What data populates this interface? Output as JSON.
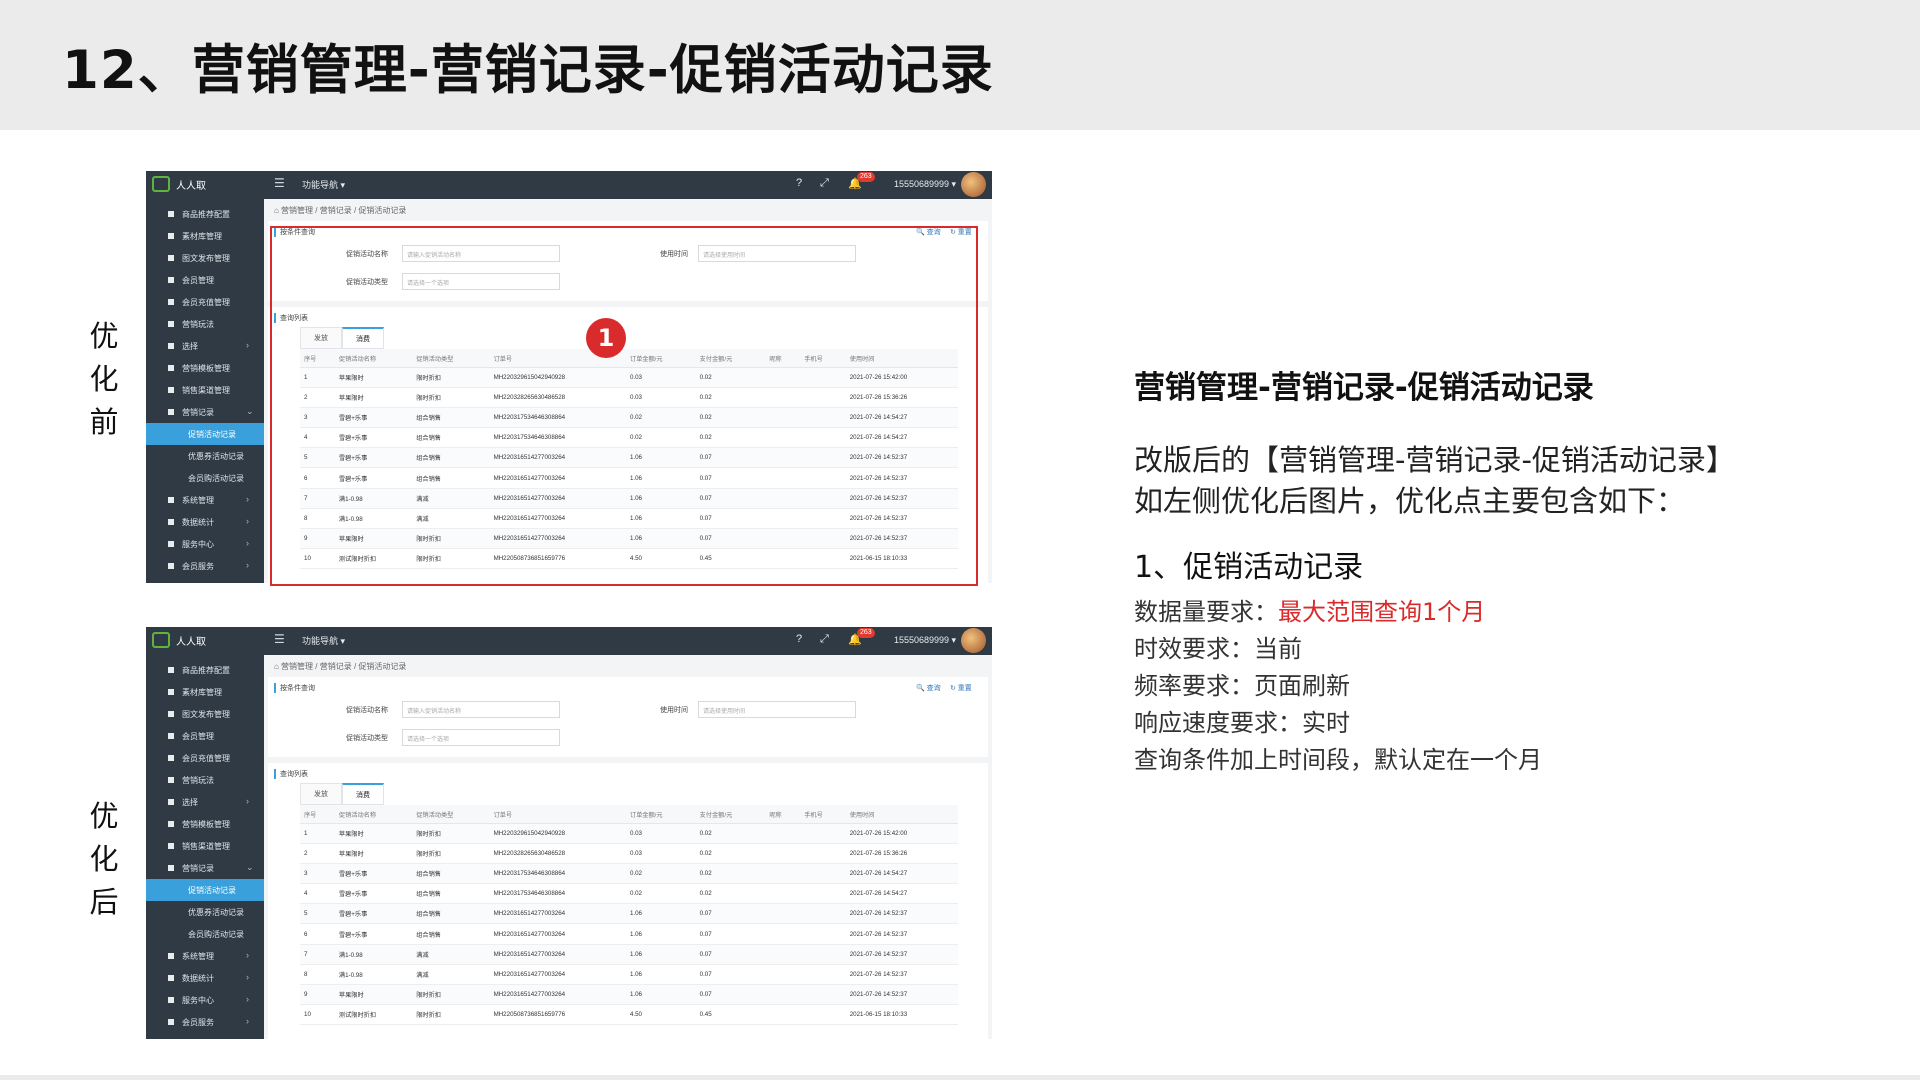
{
  "slide": {
    "title": "12、营销管理-营销记录-促销活动记录",
    "label_before": [
      "优",
      "化",
      "前"
    ],
    "label_after": [
      "优",
      "化",
      "后"
    ],
    "marker": "1"
  },
  "app": {
    "brand": "人人取",
    "nav": "功能导航 ▾",
    "help": "?",
    "fullscreen": "⤢",
    "bell": "♫",
    "badge": "263",
    "user": "15550689999 ▾",
    "sidebar": [
      {
        "label": "商品推荐配置",
        "chev": ""
      },
      {
        "label": "素材库管理",
        "chev": ""
      },
      {
        "label": "图文发布管理",
        "chev": ""
      },
      {
        "label": "会员管理",
        "chev": ""
      },
      {
        "label": "会员充值管理",
        "chev": ""
      },
      {
        "label": "营销玩法",
        "chev": ""
      },
      {
        "label": "选择",
        "chev": "›"
      },
      {
        "label": "营销模板管理",
        "chev": ""
      },
      {
        "label": "销售渠道管理",
        "chev": ""
      },
      {
        "label": "营销记录",
        "chev": "⌄"
      },
      {
        "label": "促销活动记录",
        "chev": "",
        "sub": true,
        "active": true
      },
      {
        "label": "优惠券活动记录",
        "chev": "",
        "sub": true
      },
      {
        "label": "会员购活动记录",
        "chev": "",
        "sub": true
      },
      {
        "label": "系统管理",
        "chev": "›"
      },
      {
        "label": "数据统计",
        "chev": "›"
      },
      {
        "label": "服务中心",
        "chev": "›"
      },
      {
        "label": "会员服务",
        "chev": "›"
      }
    ],
    "breadcrumb": "⌂  营销管理 / 营销记录 / 促销活动记录",
    "query": {
      "title": "按条件查询",
      "name_label": "促销活动名称",
      "name_placeholder": "请输入促销活动名称",
      "time_label": "使用时间",
      "time_placeholder": "请选择使用时间",
      "type_label": "促销活动类型",
      "type_placeholder": "请选择一个选项",
      "search": "🔍 查询",
      "reset": "↻ 重置"
    },
    "list_title": "查询列表",
    "tabs": [
      "发放",
      "消费"
    ],
    "columns": [
      "序号",
      "促销活动名称",
      "促销活动类型",
      "订单号",
      "订单金额/元",
      "支付金额/元",
      "昵称",
      "手机号",
      "使用时间"
    ],
    "rows": [
      [
        "1",
        "苹果限时",
        "限时折扣",
        "MH2203296150429409​28",
        "0.03",
        "0.02",
        "",
        "",
        "2021-07-26 15:42:00"
      ],
      [
        "2",
        "苹果限时",
        "限时折扣",
        "MH220328265630486528",
        "0.03",
        "0.02",
        "",
        "",
        "2021-07-26 15:36:26"
      ],
      [
        "3",
        "雪碧+乐事",
        "组合销售",
        "MH220317534646308864",
        "0.02",
        "0.02",
        "",
        "",
        "2021-07-26 14:54:27"
      ],
      [
        "4",
        "雪碧+乐事",
        "组合销售",
        "MH220317534646308864",
        "0.02",
        "0.02",
        "",
        "",
        "2021-07-26 14:54:27"
      ],
      [
        "5",
        "雪碧+乐事",
        "组合销售",
        "MH220316514277003264",
        "1.06",
        "0.07",
        "",
        "",
        "2021-07-26 14:52:37"
      ],
      [
        "6",
        "雪碧+乐事",
        "组合销售",
        "MH220316514277003264",
        "1.06",
        "0.07",
        "",
        "",
        "2021-07-26 14:52:37"
      ],
      [
        "7",
        "满1-0.98",
        "满减",
        "MH220316514277003264",
        "1.06",
        "0.07",
        "",
        "",
        "2021-07-26 14:52:37"
      ],
      [
        "8",
        "满1-0.98",
        "满减",
        "MH220316514277003264",
        "1.06",
        "0.07",
        "",
        "",
        "2021-07-26 14:52:37"
      ],
      [
        "9",
        "苹果限时",
        "限时折扣",
        "MH220316514277003264",
        "1.06",
        "0.07",
        "",
        "",
        "2021-07-26 14:52:37"
      ],
      [
        "10",
        "测试限时折扣",
        "限时折扣",
        "MH220508736851659776",
        "4.50",
        "0.45",
        "",
        "",
        "2021-06-15 18:10:33"
      ]
    ]
  },
  "right": {
    "title": "营销管理-营销记录-促销活动记录",
    "desc1": "改版后的【营销管理-营销记录-促销活动记录】",
    "desc2": "如左侧优化后图片，优化点主要包含如下：",
    "point": "1、促销活动记录",
    "req_data_label": "数据量要求：",
    "req_data_value": "最大范围查询1个月",
    "req_time": "时效要求：当前",
    "req_freq": "频率要求：页面刷新",
    "req_speed": "响应速度要求：实时",
    "req_note": "查询条件加上时间段，默认定在一个月"
  },
  "colors": {
    "accent": "#3aa0db",
    "highlight": "#d92b2b",
    "sidebar": "#2f3a45"
  }
}
